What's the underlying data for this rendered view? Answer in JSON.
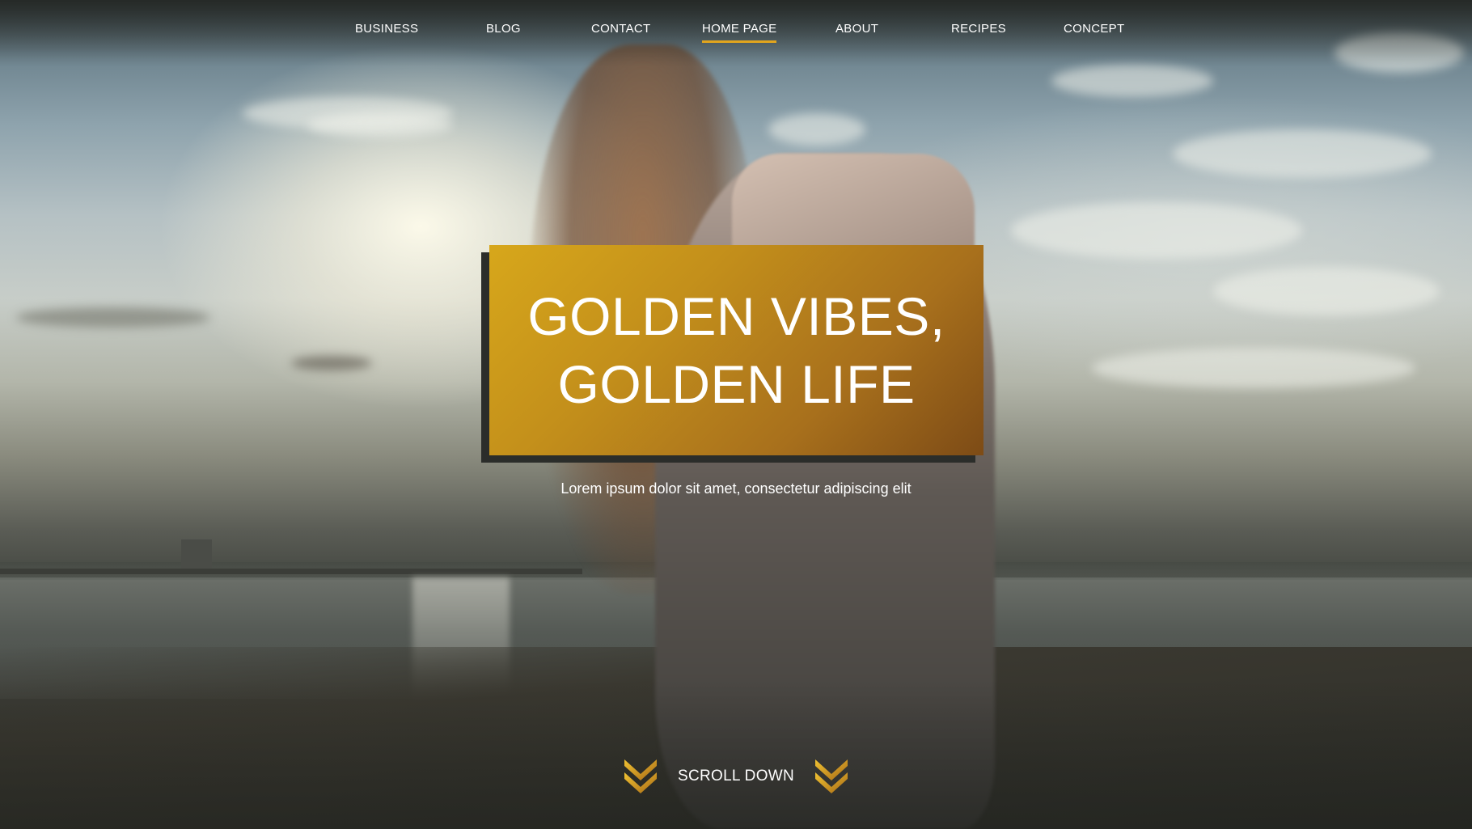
{
  "nav": {
    "items": [
      {
        "label": "BUSINESS",
        "active": false
      },
      {
        "label": "BLOG",
        "active": false
      },
      {
        "label": "CONTACT",
        "active": false
      },
      {
        "label": "HOME PAGE",
        "active": true
      },
      {
        "label": "ABOUT",
        "active": false
      },
      {
        "label": "RECIPES",
        "active": false
      },
      {
        "label": "CONCEPT",
        "active": false
      }
    ]
  },
  "hero": {
    "title_line_1": "GOLDEN VIBES,",
    "title_line_2": "GOLDEN LIFE",
    "subtitle": "Lorem ipsum dolor sit amet, consectetur adipiscing elit",
    "scroll_label": "SCROLL DOWN",
    "scroll_icon": "double-chevron-down-icon"
  },
  "colors": {
    "accent": "#e2a51d",
    "title_box_start": "#d7a71b",
    "title_box_end": "#7d4b16",
    "text": "#ffffff",
    "shadow_box": "#2b2d2a"
  }
}
